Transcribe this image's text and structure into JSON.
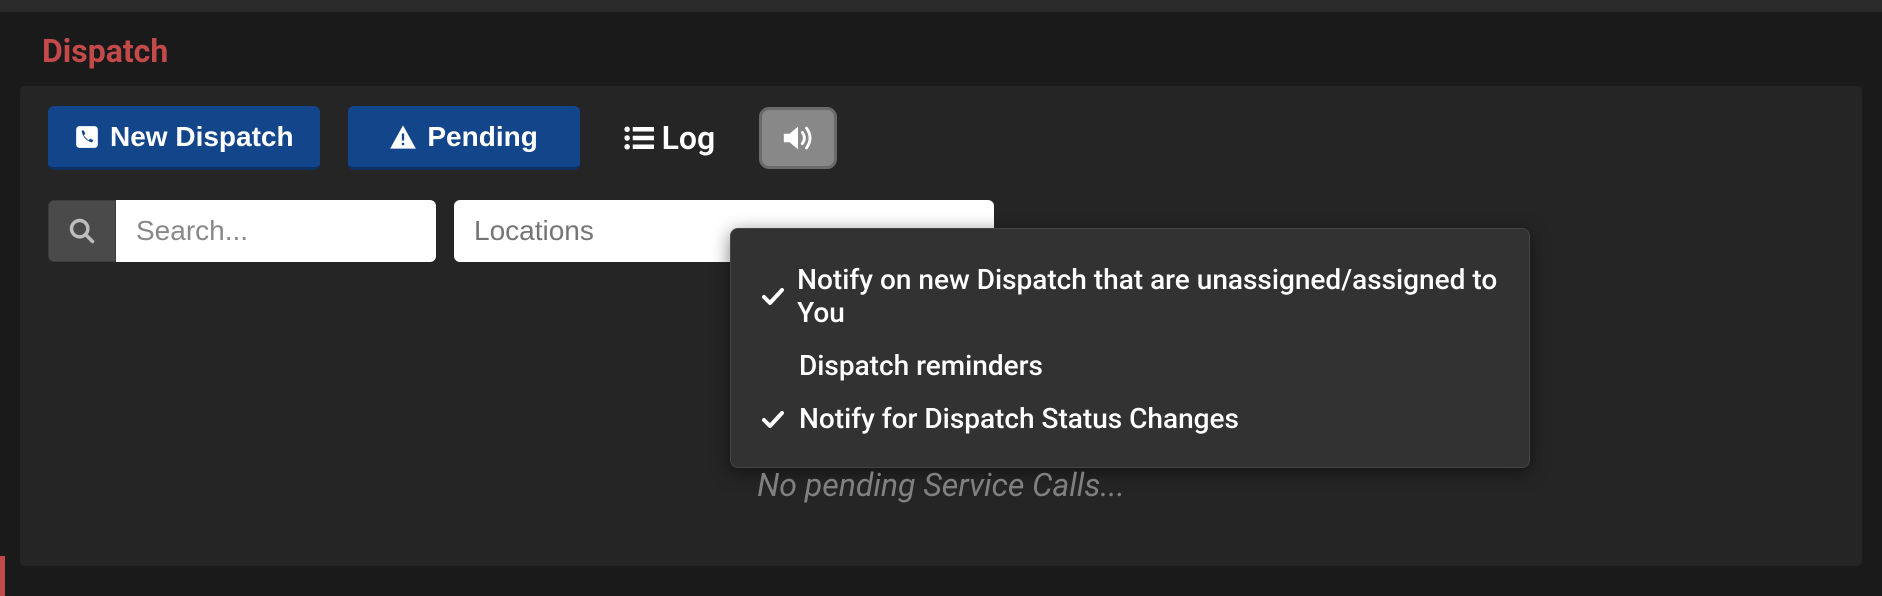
{
  "page": {
    "title": "Dispatch"
  },
  "toolbar": {
    "new_dispatch_label": "New Dispatch",
    "pending_label": "Pending",
    "log_label": "Log"
  },
  "filters": {
    "search_placeholder": "Search...",
    "locations_placeholder": "Locations"
  },
  "dropdown": {
    "items": [
      {
        "checked": true,
        "label": "Notify on new Dispatch that are unassigned/assigned to You"
      },
      {
        "checked": false,
        "label": "Dispatch reminders"
      },
      {
        "checked": true,
        "label": "Notify for Dispatch Status Changes"
      }
    ]
  },
  "empty_state": "No pending Service Calls...",
  "colors": {
    "accent_red": "#c44a4a",
    "primary_blue": "#13458a",
    "background": "#1a1a1a",
    "card": "#252525"
  }
}
